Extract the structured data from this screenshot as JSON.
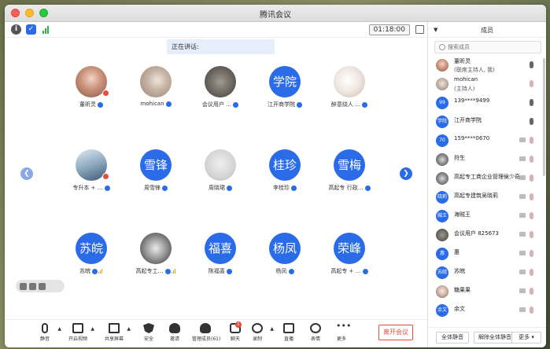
{
  "window": {
    "title": "腾讯会议"
  },
  "topbar": {
    "timer": "01:18:00"
  },
  "speaking": {
    "label": "正在讲话:"
  },
  "grid": {
    "tiles": [
      {
        "name": "董昕灵",
        "avatar": "photo-a",
        "text": ""
      },
      {
        "name": "mohican",
        "avatar": "photo-b",
        "text": ""
      },
      {
        "name": "会议用户 …",
        "avatar": "photo-c",
        "text": ""
      },
      {
        "name": "江开商学院",
        "avatar": "text",
        "text": "学院"
      },
      {
        "name": "醉意绕人 …",
        "avatar": "photo-d",
        "text": ""
      },
      {
        "name": "专升本 + …",
        "avatar": "photo-e",
        "text": ""
      },
      {
        "name": "周雪锋",
        "avatar": "text",
        "text": "雪锋"
      },
      {
        "name": "周晓珺",
        "avatar": "photo-f",
        "text": ""
      },
      {
        "name": "李桂珍",
        "avatar": "text",
        "text": "桂珍"
      },
      {
        "name": "高起专 行政…",
        "avatar": "text",
        "text": "雪梅"
      },
      {
        "name": "苏皖",
        "avatar": "text",
        "text": "苏皖"
      },
      {
        "name": "高起专工…",
        "avatar": "photo-g",
        "text": ""
      },
      {
        "name": "陈福喜",
        "avatar": "text",
        "text": "福喜"
      },
      {
        "name": "杨凤",
        "avatar": "text",
        "text": "杨凤"
      },
      {
        "name": "高起专 + …",
        "avatar": "text",
        "text": "荣峰"
      }
    ]
  },
  "toolbar": {
    "mute": "静音",
    "video": "开启视频",
    "share": "共享屏幕",
    "security": "安全",
    "invite": "邀请",
    "manage": "管理成员(61)",
    "chat": "聊天",
    "chat_badge": "1",
    "record": "录制",
    "live": "直播",
    "emoji": "表情",
    "more": "更多",
    "leave": "离开会议"
  },
  "panel": {
    "title": "成员",
    "search_placeholder": "搜索成员",
    "members": [
      {
        "name": "董昕灵",
        "sub": "(联席主持人, 我)",
        "av": "photo-a",
        "text": ""
      },
      {
        "name": "mohican",
        "sub": "(主持人)",
        "av": "photo-b",
        "text": ""
      },
      {
        "name": "139****9499",
        "sub": "",
        "av": "text",
        "text": "99"
      },
      {
        "name": "江开商学院",
        "sub": "",
        "av": "text",
        "text": "学院"
      },
      {
        "name": "159****0670",
        "sub": "",
        "av": "text",
        "text": "70"
      },
      {
        "name": "符生",
        "sub": "",
        "av": "photo-c",
        "text": ""
      },
      {
        "name": "高起专工商企业管理侯少奇",
        "sub": "",
        "av": "photo-c",
        "text": ""
      },
      {
        "name": "高起专建筑吴晓莉",
        "sub": "",
        "av": "text",
        "text": "晓莉"
      },
      {
        "name": "海贼王",
        "sub": "",
        "av": "text",
        "text": "贼王"
      },
      {
        "name": "会议用户 825673",
        "sub": "",
        "av": "photo-d",
        "text": ""
      },
      {
        "name": "惠",
        "sub": "",
        "av": "text",
        "text": "惠"
      },
      {
        "name": "苏皖",
        "sub": "",
        "av": "text",
        "text": "苏皖"
      },
      {
        "name": "糖果果",
        "sub": "",
        "av": "photo-e",
        "text": ""
      },
      {
        "name": "余文",
        "sub": "",
        "av": "text",
        "text": "余文"
      }
    ],
    "mute_all": "全体静音",
    "unmute_all": "解除全体静音",
    "more": "更多 ▾"
  },
  "colors": {
    "accent": "#2a6be8",
    "danger": "#e74c3c"
  }
}
